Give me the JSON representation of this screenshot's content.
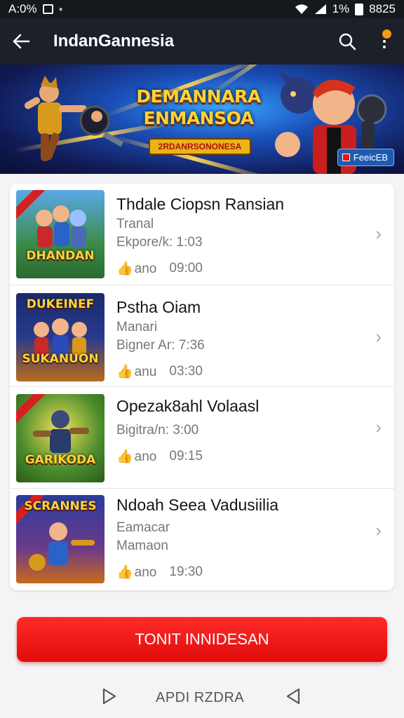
{
  "status": {
    "time_left": "A:0%",
    "battery_text": "1%",
    "clock": "8825"
  },
  "app_bar": {
    "title": "IndanGannesia"
  },
  "banner": {
    "title_line1": "DEMANNARA",
    "title_line2": "ENMANSOA",
    "subtitle": "2RDANRSONONESA",
    "badge": "FeeicEB"
  },
  "list": [
    {
      "title": "Thdale Ciopsn Ransian",
      "line1": "Tranal",
      "line2": "Ekpore/k: 1:03",
      "likes": "ano",
      "time": "09:00",
      "thumb_top": "",
      "thumb_label": "DHANDAN",
      "thumb_bg": "#3c8c4a"
    },
    {
      "title": "Pstha Oiam",
      "line1": "Manari",
      "line2": "Bigner Ar: 7:36",
      "likes": "anu",
      "time": "03:30",
      "thumb_top": "DUKEINEF",
      "thumb_label": "SUKANUON",
      "thumb_bg": "#283a8c"
    },
    {
      "title": "Opezak8ahl Volaasl",
      "line1": "",
      "line2": "Bigitra/n: 3:00",
      "likes": "ano",
      "time": "09:15",
      "thumb_top": "",
      "thumb_label": "GARIKODA",
      "thumb_bg": "#4a8c2c"
    },
    {
      "title": "Ndoah Seea Vadusiilia",
      "line1": "Eamacar",
      "line2": "Mamaon",
      "likes": "ano",
      "time": "19:30",
      "thumb_top": "SCRANNES",
      "thumb_label": "",
      "thumb_bg": "#2a3d9a"
    }
  ],
  "cta": {
    "label": "TONIT INNIDESAN"
  },
  "nav": {
    "label": "APDI RZDRA"
  },
  "colors": {
    "accent": "#f21414",
    "app_bar": "#1b2029"
  }
}
